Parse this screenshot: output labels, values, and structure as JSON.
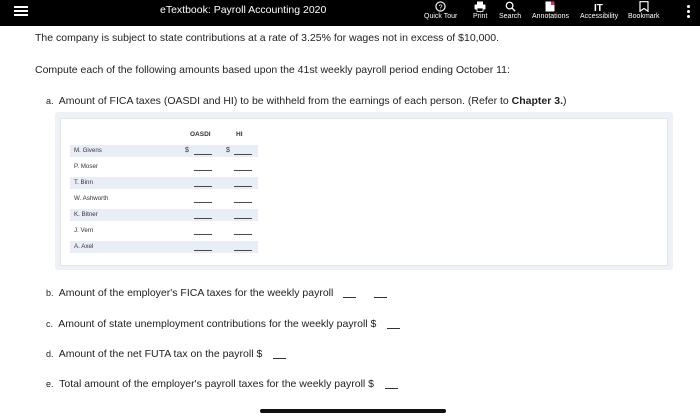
{
  "app": {
    "title": "eTextbook: Payroll Accounting 2020"
  },
  "toolbar": {
    "quick_tour": "Quick Tour",
    "print": "Print",
    "search": "Search",
    "annotations": "Annotations",
    "accessibility": "Accessibility",
    "bookmark": "Bookmark"
  },
  "problem": {
    "intro": "The company is subject to state contributions at a rate of 3.25% for wages not in excess of $10,000.",
    "instruction": "Compute each of the following amounts based upon the 41st weekly payroll period ending October 11:",
    "part_a": {
      "prefix": "a.",
      "text": "Amount of FICA taxes (OASDI and HI) to be withheld from the earnings of each person. (Refer to ",
      "ref": "Chapter 3.",
      "suffix": ")"
    },
    "table": {
      "col_oasdi": "OASDI",
      "col_hi": "HI",
      "dollar": "$",
      "rows": [
        "M. Givens",
        "P. Moser",
        "T. Binn",
        "W. Ashworth",
        "K. Bitner",
        "J. Vern",
        "A. Axel"
      ]
    },
    "part_b": {
      "prefix": "b.",
      "text": "Amount of the employer's FICA taxes for the weekly payroll"
    },
    "part_c": {
      "prefix": "c.",
      "text": "Amount of state unemployment contributions for the weekly payroll $"
    },
    "part_d": {
      "prefix": "d.",
      "text": "Amount of the net FUTA tax on the payroll $"
    },
    "part_e": {
      "prefix": "e.",
      "text": "Total amount of the employer's payroll taxes for the weekly payroll $"
    }
  }
}
